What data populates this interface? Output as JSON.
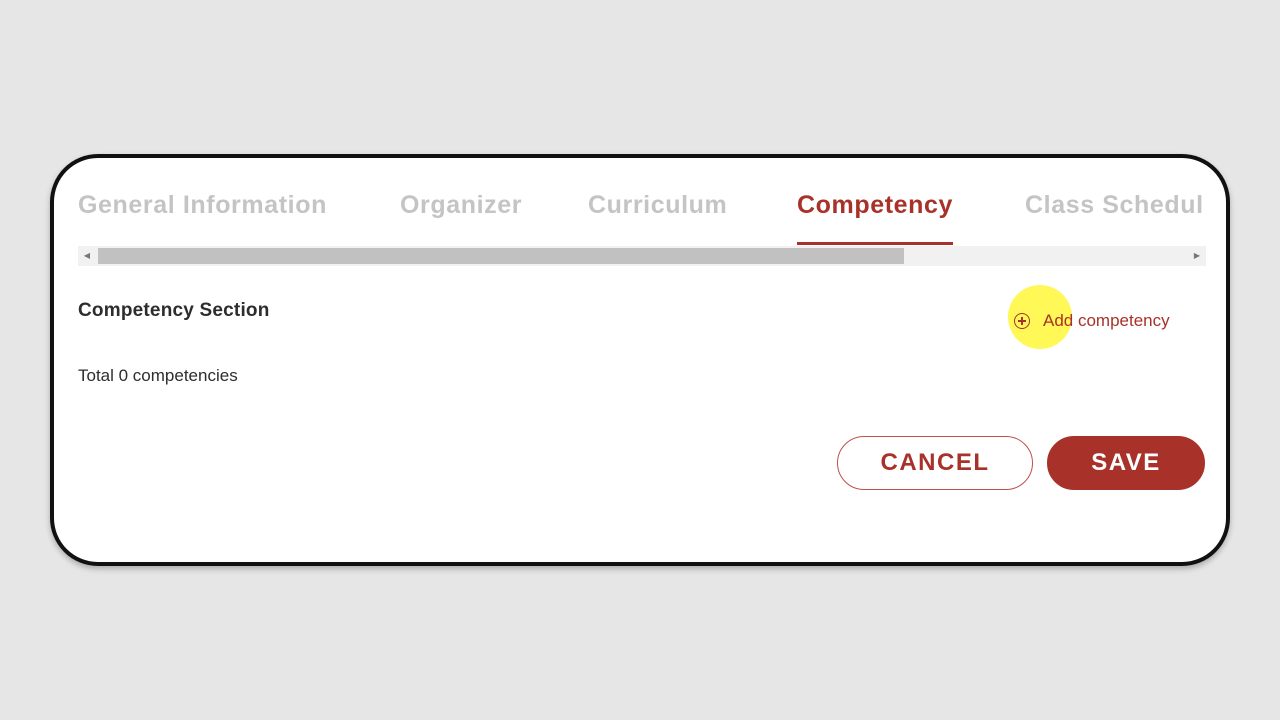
{
  "tabs": [
    {
      "label": "General Information",
      "active": false
    },
    {
      "label": "Organizer",
      "active": false
    },
    {
      "label": "Curriculum",
      "active": false
    },
    {
      "label": "Competency",
      "active": true
    },
    {
      "label": "Class Schedul",
      "active": false
    }
  ],
  "section": {
    "title": "Competency Section",
    "add_label": "Add competency",
    "total_text": "Total 0 competencies"
  },
  "actions": {
    "cancel_label": "CANCEL",
    "save_label": "SAVE"
  },
  "colors": {
    "accent": "#a83229",
    "inactive_tab": "#c4c4c4",
    "background": "#e6e6e6",
    "highlight": "#fff51e"
  },
  "icons": {
    "add": "plus-circle-icon",
    "scroll_left": "triangle-left-icon",
    "scroll_right": "triangle-right-icon"
  }
}
